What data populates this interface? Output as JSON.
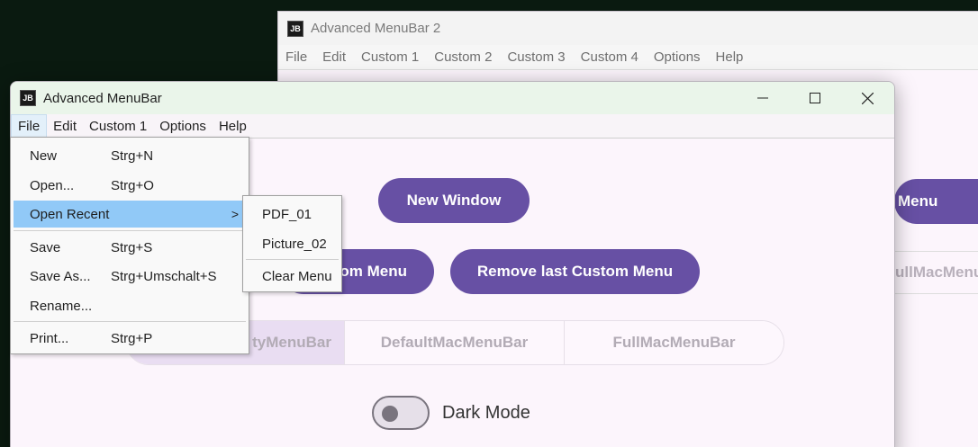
{
  "back_window": {
    "logo": "JB",
    "title": "Advanced MenuBar 2",
    "menubar": [
      "File",
      "Edit",
      "Custom 1",
      "Custom 2",
      "Custom 3",
      "Custom 4",
      "Options",
      "Help"
    ],
    "partial_button": "Menu",
    "partial_segment": "ullMacMenu"
  },
  "main_window": {
    "logo": "JB",
    "title": "Advanced MenuBar",
    "controls": {
      "minimize": "—",
      "maximize": "☐",
      "close": "✕"
    },
    "menubar": [
      "File",
      "Edit",
      "Custom 1",
      "Options",
      "Help"
    ],
    "buttons": {
      "new_window": "New Window",
      "add_custom_menu": "om Menu",
      "remove_custom_menu": "Remove last Custom Menu"
    },
    "segments": [
      "tyMenuBar",
      "DefaultMacMenuBar",
      "FullMacMenuBar"
    ],
    "dark_mode_label": "Dark Mode",
    "dark_mode_on": false
  },
  "file_menu": {
    "items": [
      {
        "label": "New",
        "accel": "Strg+N"
      },
      {
        "label": "Open...",
        "accel": "Strg+O"
      },
      {
        "label": "Open Recent",
        "accel": "",
        "submenu_arrow": ">"
      },
      {
        "label": "Save",
        "accel": "Strg+S"
      },
      {
        "label": "Save As...",
        "accel": "Strg+Umschalt+S"
      },
      {
        "label": "Rename...",
        "accel": ""
      },
      {
        "label": "Print...",
        "accel": "Strg+P"
      }
    ]
  },
  "recent_menu": {
    "items": [
      "PDF_01",
      "Picture_02",
      "Clear Menu"
    ]
  }
}
